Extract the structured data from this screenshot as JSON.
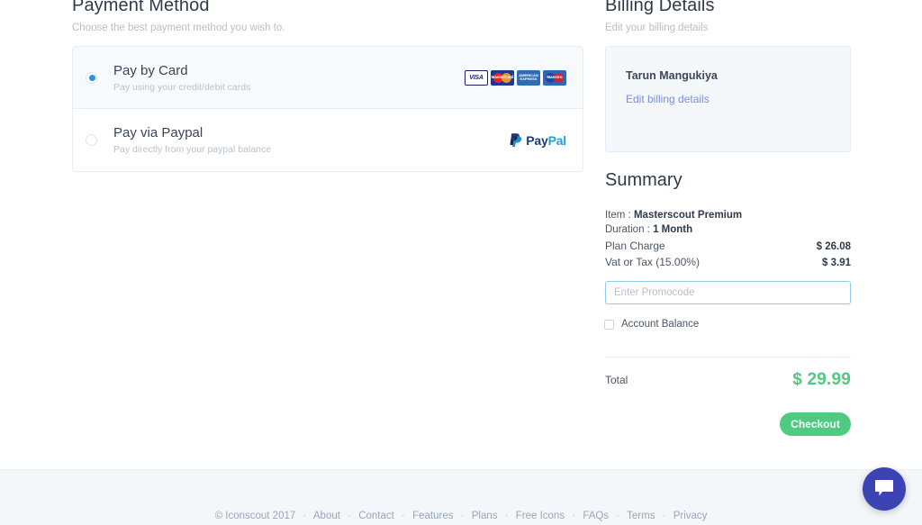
{
  "payment": {
    "title": "Payment Method",
    "subtitle": "Choose the best payment method you wish to.",
    "methods": [
      {
        "name": "Pay by Card",
        "desc": "Pay using your credit/debit cards",
        "selected": true,
        "logos": [
          "visa-logo",
          "mastercard-logo",
          "amex-logo",
          "maestro-logo"
        ],
        "logo_labels": {
          "visa": "VISA",
          "mastercard": "MasterCard",
          "amex_line1": "AMERICAN",
          "amex_line2": "EXPRESS",
          "maestro": "Maestro"
        }
      },
      {
        "name": "Pay via Paypal",
        "desc": "Pay directly from your paypal balance",
        "selected": false,
        "logos": [
          "paypal-logo"
        ],
        "logo_labels": {
          "paypal_pay": "Pay",
          "paypal_pal": "Pal"
        }
      }
    ]
  },
  "billing": {
    "title": "Billing Details",
    "subtitle": "Edit your billing details",
    "name": "Tarun Mangukiya",
    "edit_link": "Edit billing details"
  },
  "summary": {
    "title": "Summary",
    "item_label": "Item :",
    "item_value": "Masterscout Premium",
    "duration_label": "Duration :",
    "duration_value": "1 Month",
    "lines": [
      {
        "label": "Plan Charge",
        "value": "$ 26.08"
      },
      {
        "label": "Vat or Tax (15.00%)",
        "value": "$ 3.91"
      }
    ],
    "promocode_placeholder": "Enter Promocode",
    "promocode_value": "",
    "account_balance_label": "Account Balance",
    "account_balance_checked": false,
    "total_label": "Total",
    "total_value": "$ 29.99",
    "checkout_label": "Checkout"
  },
  "footer": {
    "copyright": "© Iconscout 2017",
    "links": [
      "About",
      "Contact",
      "Features",
      "Plans",
      "Free Icons",
      "FAQs",
      "Terms",
      "Privacy"
    ],
    "separator": "·"
  },
  "chat": {
    "icon": "chat-bubble-icon"
  },
  "colors": {
    "accent_green": "#4ecb80",
    "radio_blue": "#2e8fe8",
    "link_purple": "#7b8cde",
    "promo_border": "#8fcdee",
    "chat_blue": "#3b43b5",
    "panel_bg": "#f4f8fb",
    "footer_bg": "#f3f7fa"
  }
}
